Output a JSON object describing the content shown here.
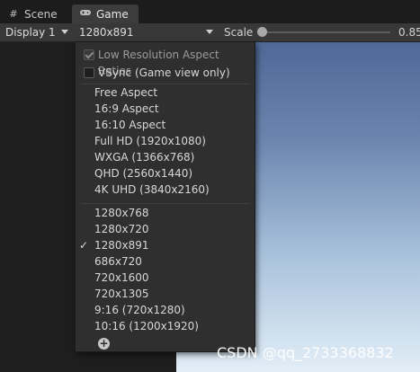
{
  "tabs": [
    {
      "label": "Scene",
      "icon": "grid-icon"
    },
    {
      "label": "Game",
      "icon": "gamepad-icon"
    }
  ],
  "toolbar": {
    "display": "Display 1",
    "resolution": "1280x891",
    "scale_label": "Scale",
    "scale_value": "0.85"
  },
  "menu": {
    "options": [
      {
        "label": "Low Resolution Aspect Ratios",
        "checked": true,
        "disabled": true
      },
      {
        "label": "VSync (Game view only)",
        "checked": false,
        "disabled": false
      }
    ],
    "aspect_presets": [
      "Free Aspect",
      "16:9 Aspect",
      "16:10 Aspect",
      "Full HD (1920x1080)",
      "WXGA (1366x768)",
      "QHD (2560x1440)",
      "4K UHD (3840x2160)"
    ],
    "custom_resolutions": [
      "1280x768",
      "1280x720",
      "1280x891",
      "686x720",
      "720x1600",
      "720x1305",
      "9:16 (720x1280)",
      "10:16 (1200x1920)"
    ],
    "selected": "1280x891",
    "check_glyph": "✓",
    "add_glyph": "+"
  },
  "watermark": "CSDN @qq_2733368832"
}
